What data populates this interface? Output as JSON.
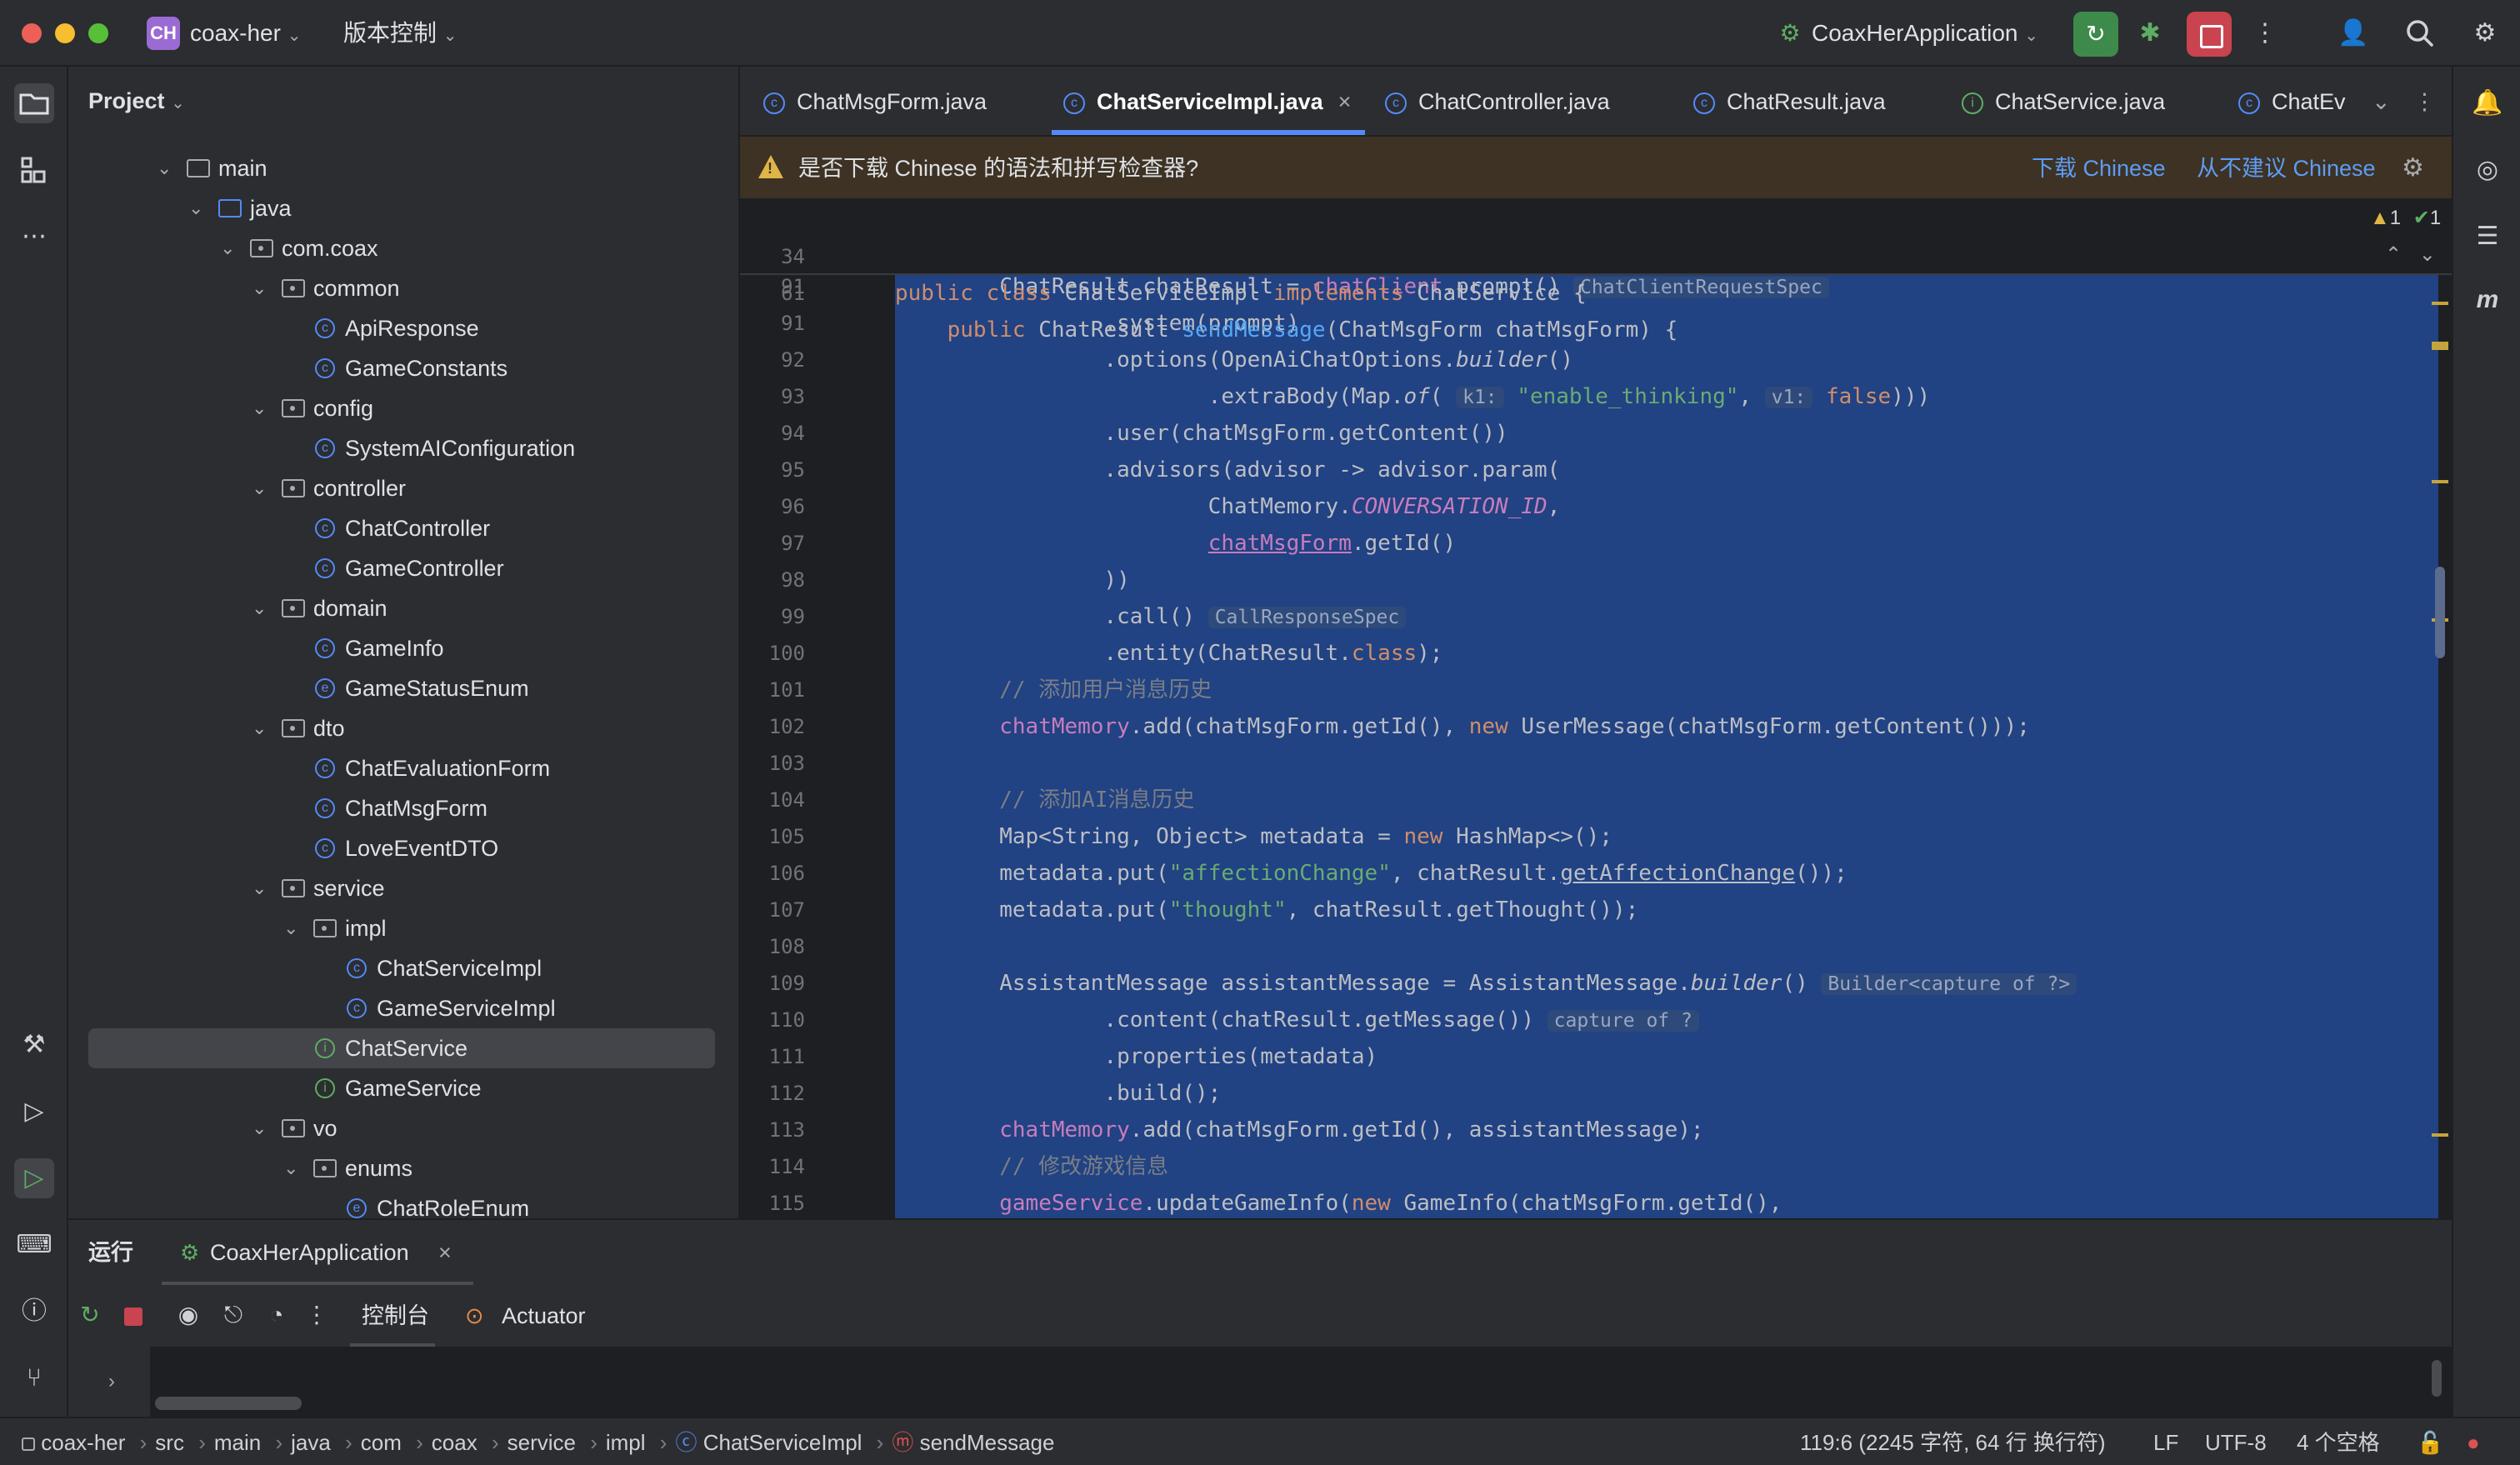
{
  "titlebar": {
    "project_badge": "CH",
    "project_name": "coax-her",
    "vcs_label": "版本控制",
    "run_config": "CoaxHerApplication",
    "icons": [
      "run-icon",
      "debug-icon",
      "stop-icon",
      "more-icon",
      "account-icon",
      "search-icon",
      "settings-icon"
    ]
  },
  "project_panel": {
    "title": "Project",
    "tree": [
      {
        "label": "main",
        "type": "folder"
      },
      {
        "label": "java",
        "type": "folder-blue"
      },
      {
        "label": "com.coax",
        "type": "package"
      },
      {
        "label": "common",
        "type": "package"
      },
      {
        "label": "ApiResponse",
        "type": "class"
      },
      {
        "label": "GameConstants",
        "type": "class"
      },
      {
        "label": "config",
        "type": "package"
      },
      {
        "label": "SystemAIConfiguration",
        "type": "class"
      },
      {
        "label": "controller",
        "type": "package"
      },
      {
        "label": "ChatController",
        "type": "class"
      },
      {
        "label": "GameController",
        "type": "class"
      },
      {
        "label": "domain",
        "type": "package"
      },
      {
        "label": "GameInfo",
        "type": "class"
      },
      {
        "label": "GameStatusEnum",
        "type": "enum"
      },
      {
        "label": "dto",
        "type": "package"
      },
      {
        "label": "ChatEvaluationForm",
        "type": "class"
      },
      {
        "label": "ChatMsgForm",
        "type": "class"
      },
      {
        "label": "LoveEventDTO",
        "type": "class"
      },
      {
        "label": "service",
        "type": "package"
      },
      {
        "label": "impl",
        "type": "package"
      },
      {
        "label": "ChatServiceImpl",
        "type": "class"
      },
      {
        "label": "GameServiceImpl",
        "type": "class"
      },
      {
        "label": "ChatService",
        "type": "interface"
      },
      {
        "label": "GameService",
        "type": "interface"
      },
      {
        "label": "vo",
        "type": "package"
      },
      {
        "label": "enums",
        "type": "package"
      },
      {
        "label": "ChatRoleEnum",
        "type": "enum"
      }
    ]
  },
  "tabs": [
    {
      "label": "ChatMsgForm.java",
      "icon": "C"
    },
    {
      "label": "ChatServiceImpl.java",
      "icon": "C",
      "close": "×"
    },
    {
      "label": "ChatController.java",
      "icon": "C"
    },
    {
      "label": "ChatResult.java",
      "icon": "C"
    },
    {
      "label": "ChatService.java",
      "icon": "I"
    },
    {
      "label": "ChatEv",
      "icon": "C"
    }
  ],
  "banner": {
    "message": "是否下载 Chinese 的语法和拼写检查器?",
    "download_link": "下载 Chinese",
    "dismiss_link": "从不建议 Chinese"
  },
  "editor": {
    "sticky": [
      {
        "ln": "34",
        "code": "public class ChatServiceImpl implements ChatService {"
      },
      {
        "ln": "61",
        "code": "    public ChatResult sendMessage(ChatMsgForm chatMsgForm) {"
      }
    ],
    "inspection": {
      "warnings": "1",
      "ok": "1"
    },
    "lines": [
      {
        "ln": "91",
        "code": "        ChatResult chatResult = chatClient.prompt()",
        "hint": "ChatClientRequestSpec"
      },
      {
        "ln": "91",
        "code": "                .system(prompt)"
      },
      {
        "ln": "92",
        "code": "                .options(OpenAiChatOptions.builder()"
      },
      {
        "ln": "93",
        "code": "                        .extraBody(Map.of(",
        "h1": "k1:",
        "s1": "\"enable_thinking\"",
        "h2": "v1:",
        "v": "false",
        "end": ")))"
      },
      {
        "ln": "94",
        "code": "                .user(chatMsgForm.getContent())"
      },
      {
        "ln": "95",
        "code": "                .advisors(advisor -> advisor.param("
      },
      {
        "ln": "96",
        "code": "                        ChatMemory.",
        "field": "CONVERSATION_ID",
        "end": ","
      },
      {
        "ln": "97",
        "code": "                        ",
        "var": "chatMsgForm",
        "end": ".getId()"
      },
      {
        "ln": "98",
        "code": "                ))"
      },
      {
        "ln": "99",
        "code": "                .call()",
        "hint": "CallResponseSpec"
      },
      {
        "ln": "100",
        "code": "                .entity(ChatResult.",
        "kw": "class",
        "end": ");"
      },
      {
        "ln": "101",
        "comment": "        // 添加用户消息历史"
      },
      {
        "ln": "102",
        "code": "chatMemory",
        "end": ".add(chatMsgForm.getId(), ",
        "kw": "new",
        "end2": " UserMessage(chatMsgForm.getContent()));"
      },
      {
        "ln": "103",
        "code": ""
      },
      {
        "ln": "104",
        "comment": "        // 添加AI消息历史"
      },
      {
        "ln": "105",
        "code": "        Map<String, Object> metadata = ",
        "kw": "new",
        "end": " HashMap<>();"
      },
      {
        "ln": "106",
        "code": "        metadata.put(",
        "s": "\"affectionChange\"",
        "end": ", chatResult.",
        "ul": "getAffectionChange",
        "end2": "());"
      },
      {
        "ln": "107",
        "code": "        metadata.put(",
        "s": "\"thought\"",
        "end": ", chatResult.getThought());"
      },
      {
        "ln": "108",
        "code": ""
      },
      {
        "ln": "109",
        "code": "        AssistantMessage assistantMessage = AssistantMessage.",
        "it": "builder",
        "end": "()",
        "hint": "Builder<capture of ?>"
      },
      {
        "ln": "110",
        "code": "                .content(chatResult.getMessage())",
        "hint": "capture of ?"
      },
      {
        "ln": "111",
        "code": "                .properties(metadata)"
      },
      {
        "ln": "112",
        "code": "                .build();"
      },
      {
        "ln": "113",
        "code": "chatMemory",
        "end": ".add(chatMsgForm.getId(), assistantMessage);"
      },
      {
        "ln": "114",
        "comment": "        // 修改游戏信息"
      },
      {
        "ln": "115",
        "code": "gameService",
        "end": ".updateGameInfo(",
        "kw": "new",
        "end2": " GameInfo(chatMsgForm.getId(),"
      }
    ]
  },
  "run_panel": {
    "title": "运行",
    "config_tab": "CoaxHerApplication",
    "close": "×",
    "console_tab": "控制台",
    "actuator_tab": "Actuator"
  },
  "statusbar": {
    "breadcrumbs": [
      "coax-her",
      "src",
      "main",
      "java",
      "com",
      "coax",
      "service",
      "impl",
      "ChatServiceImpl",
      "sendMessage"
    ],
    "separator": "›",
    "position": "119:6 (2245 字符, 64 行 换行符)",
    "line_sep": "LF",
    "encoding": "UTF-8",
    "indent": "4 个空格"
  },
  "colors": {
    "bg_editor": "#1e1f22",
    "bg_panel": "#2b2d30",
    "selection": "#214283",
    "accent_blue": "#548af7",
    "keyword": "#cf8e6d",
    "string": "#6aab73",
    "banner_bg": "#3d3223"
  }
}
